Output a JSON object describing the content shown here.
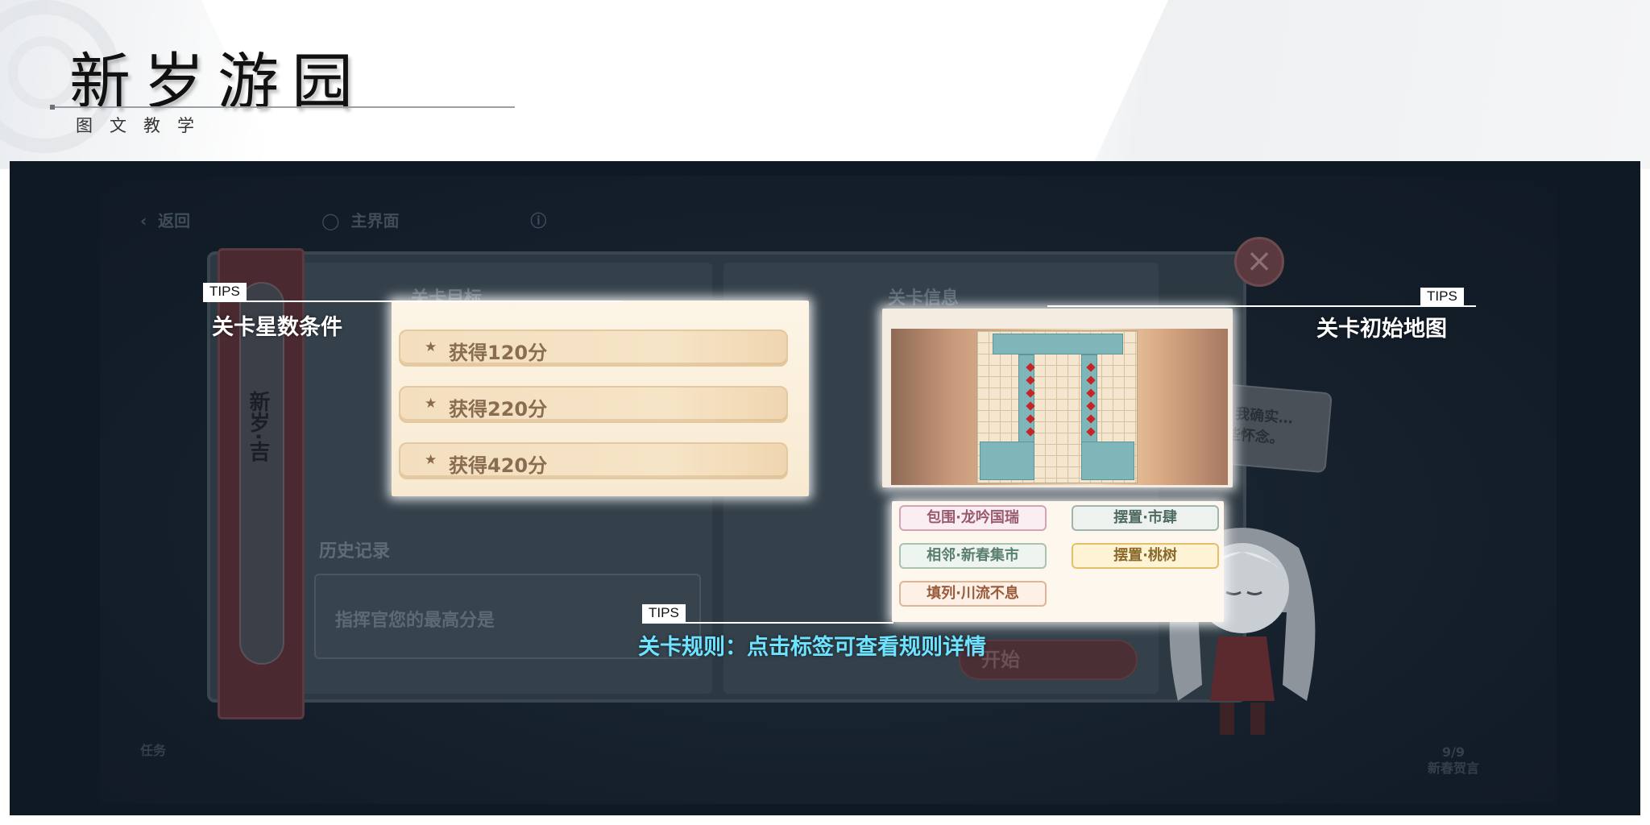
{
  "header": {
    "title": "新岁游园",
    "subtitle": "图文教学"
  },
  "game": {
    "topbar": {
      "back_label": "返回",
      "home_label": "主界面"
    },
    "spine_title": "新岁·吉",
    "goals_heading": "关卡目标",
    "goals": [
      {
        "label": "获得120分"
      },
      {
        "label": "获得220分"
      },
      {
        "label": "获得420分"
      }
    ],
    "info_heading": "关卡信息",
    "history_heading": "历史记录",
    "history_text": "指挥官您的最高分是",
    "rule_tags": [
      {
        "label": "包围·龙吟国瑞"
      },
      {
        "label": "摆置·市肆"
      },
      {
        "label": "相邻·新春集市"
      },
      {
        "label": "摆置·桃树"
      },
      {
        "label": "填列·川流不息"
      }
    ],
    "start_label": "开始",
    "speech_line1": "庙会？我确实…",
    "speech_line2": "…有些怀念。",
    "bottom_left_label": "任务",
    "bottom_right_count": "9/9",
    "bottom_right_label": "新春贺言"
  },
  "tips": [
    {
      "badge": "TIPS",
      "label": "关卡星数条件"
    },
    {
      "badge": "TIPS",
      "label": "关卡初始地图"
    },
    {
      "badge": "TIPS",
      "label": "关卡规则：点击标签可查看规则详情"
    }
  ],
  "colors": {
    "panel_bg": "#0f1924",
    "tips_highlight": "#6de3ff",
    "goal_text": "#8a6c50"
  }
}
